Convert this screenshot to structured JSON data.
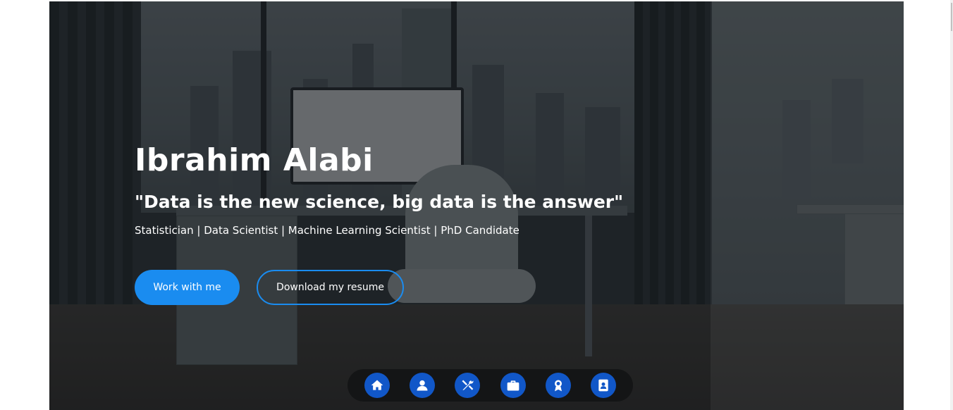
{
  "hero": {
    "name": "Ibrahim Alabi",
    "quote": "\"Data is the new science, big data is the answer\"",
    "roles": "Statistician | Data Scientist | Machine Learning Scientist | PhD Candidate",
    "primary_button": "Work with me",
    "secondary_button": "Download my resume"
  },
  "nav": {
    "items": [
      {
        "icon": "home-icon"
      },
      {
        "icon": "user-icon"
      },
      {
        "icon": "tools-icon"
      },
      {
        "icon": "briefcase-icon"
      },
      {
        "icon": "award-icon"
      },
      {
        "icon": "contact-card-icon"
      }
    ]
  },
  "colors": {
    "accent": "#1a8cf0",
    "nav_button": "#1157c8",
    "nav_bar": "#141516"
  }
}
